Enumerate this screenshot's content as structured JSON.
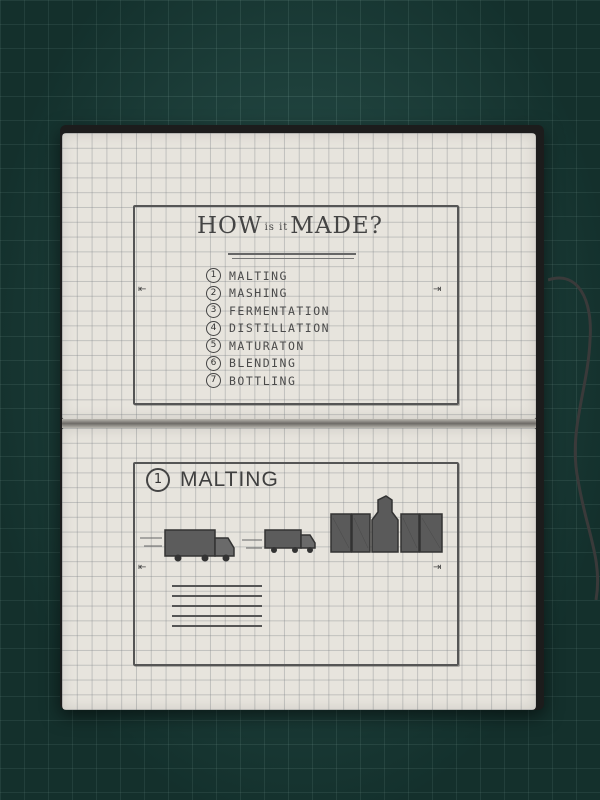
{
  "top_page": {
    "title_how": "HOW",
    "title_is_it": "is it",
    "title_made": "MADE?",
    "steps": [
      {
        "num": "1",
        "label": "MALTING"
      },
      {
        "num": "2",
        "label": "MASHING"
      },
      {
        "num": "3",
        "label": "FERMENTATION"
      },
      {
        "num": "4",
        "label": "DISTILLATION"
      },
      {
        "num": "5",
        "label": "MATURATON"
      },
      {
        "num": "6",
        "label": "BLENDING"
      },
      {
        "num": "7",
        "label": "BOTTLING"
      }
    ],
    "left_arrow": "⇤",
    "right_arrow": "⇥"
  },
  "bottom_page": {
    "section_num": "1",
    "section_title": "MALTING",
    "left_arrow": "⇤",
    "right_arrow": "⇥"
  },
  "colors": {
    "mat": "#1e4a44",
    "paper": "#e7e4dd",
    "pencil": "#4a4a4a"
  }
}
